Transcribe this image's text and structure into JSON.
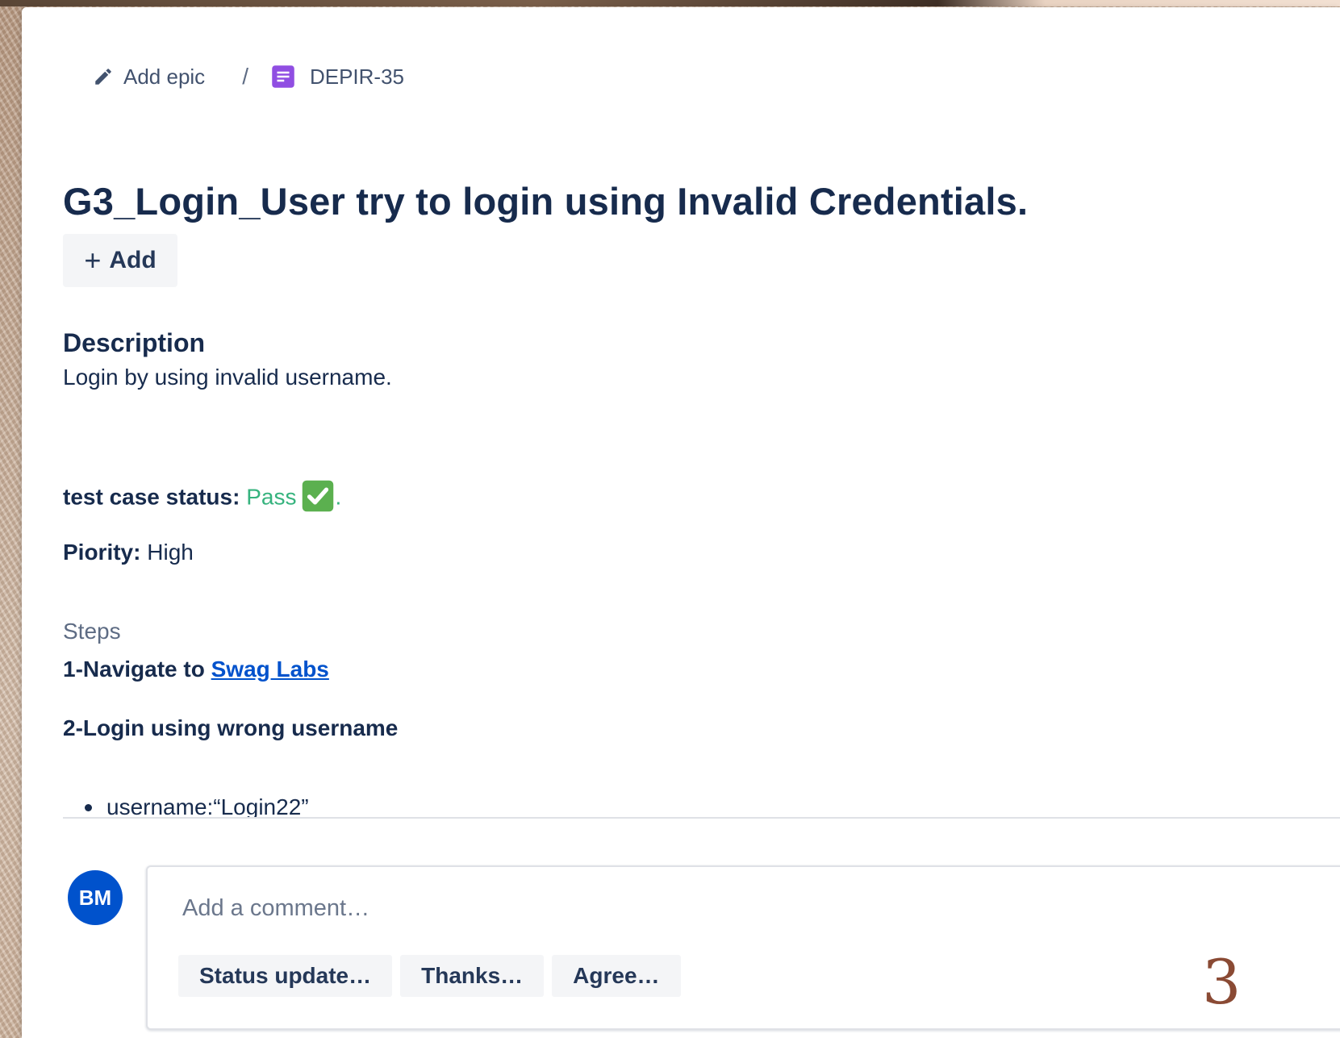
{
  "breadcrumb": {
    "add_epic": "Add epic",
    "separator": "/",
    "issue_key": "DEPIR-35"
  },
  "issue": {
    "title": "G3_Login_User try to login using Invalid Credentials.",
    "add_button_label": "Add",
    "add_button_icon": "+"
  },
  "description": {
    "heading": "Description",
    "summary": "Login by using invalid username.",
    "status_label": "test case status:",
    "status_value": "Pass",
    "status_suffix": ".",
    "priority_label": "Piority:",
    "priority_value": "High",
    "steps_heading": "Steps",
    "step1_text": "1-Navigate to",
    "step1_link": "Swag Labs",
    "step2_text": "2-Login using wrong username",
    "bullet_text": "username:“Login22”"
  },
  "comment": {
    "avatar_initials": "BM",
    "placeholder": "Add a comment…",
    "quick_replies": [
      "Status update…",
      "Thanks…",
      "Agree…"
    ]
  },
  "overlay": {
    "page_number": "3"
  },
  "colors": {
    "title": "#172b4d",
    "pass": "#36b37e",
    "link": "#0052cc",
    "avatar": "#0052cc",
    "issue_icon": "#904ee2",
    "check_icon": "#5bb04f",
    "page_number": "#8a4a34"
  },
  "icons": {
    "add_epic": "pencil-icon",
    "issue_type": "issue-type-icon",
    "status": "check-mark-icon"
  }
}
